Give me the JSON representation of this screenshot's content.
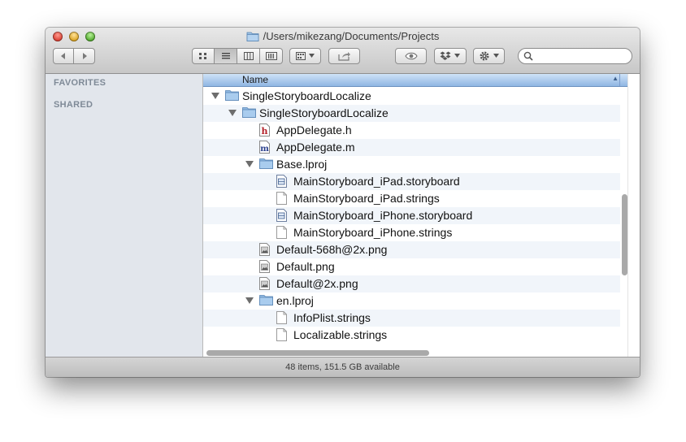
{
  "window": {
    "title": "/Users/mikezang/Documents/Projects"
  },
  "sidebar": {
    "favorites": "FAVORITES",
    "shared": "SHARED"
  },
  "columns": {
    "name": "Name"
  },
  "files": [
    {
      "name": "SingleStoryboardLocalize",
      "kind": "folder",
      "depth": 0,
      "expanded": true
    },
    {
      "name": "SingleStoryboardLocalize",
      "kind": "folder",
      "depth": 1,
      "expanded": true
    },
    {
      "name": "AppDelegate.h",
      "kind": "h-file",
      "depth": 2
    },
    {
      "name": "AppDelegate.m",
      "kind": "m-file",
      "depth": 2
    },
    {
      "name": "Base.lproj",
      "kind": "folder",
      "depth": 2,
      "expanded": true
    },
    {
      "name": "MainStoryboard_iPad.storyboard",
      "kind": "storyboard",
      "depth": 3
    },
    {
      "name": "MainStoryboard_iPad.strings",
      "kind": "doc",
      "depth": 3
    },
    {
      "name": "MainStoryboard_iPhone.storyboard",
      "kind": "storyboard",
      "depth": 3
    },
    {
      "name": "MainStoryboard_iPhone.strings",
      "kind": "doc",
      "depth": 3
    },
    {
      "name": "Default-568h@2x.png",
      "kind": "image",
      "depth": 2
    },
    {
      "name": "Default.png",
      "kind": "image",
      "depth": 2
    },
    {
      "name": "Default@2x.png",
      "kind": "image",
      "depth": 2
    },
    {
      "name": "en.lproj",
      "kind": "folder",
      "depth": 2,
      "expanded": true
    },
    {
      "name": "InfoPlist.strings",
      "kind": "doc",
      "depth": 3
    },
    {
      "name": "Localizable.strings",
      "kind": "doc",
      "depth": 3
    }
  ],
  "status": {
    "text": "48 items, 151.5 GB available"
  }
}
